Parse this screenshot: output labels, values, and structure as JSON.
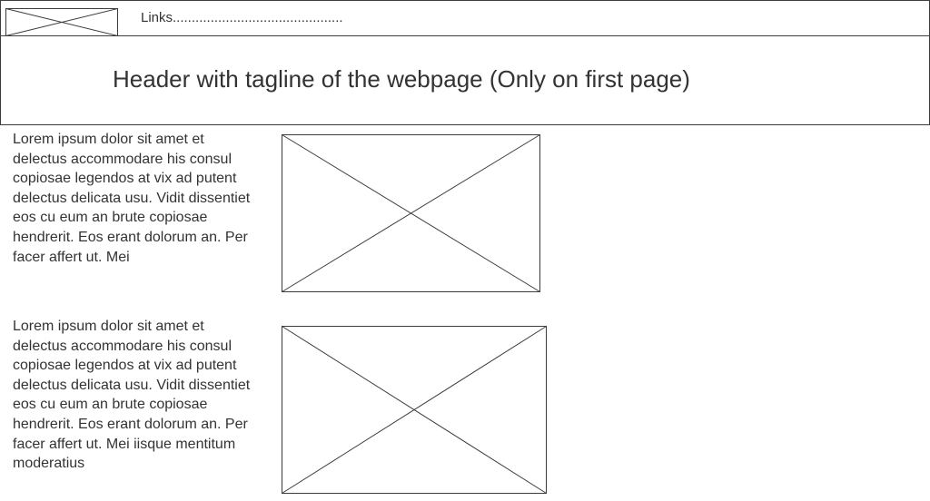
{
  "nav": {
    "links_label": "Links.............................................",
    "logo_icon": "image-placeholder-icon"
  },
  "header": {
    "tagline": "Header with tagline of the webpage (Only on first page)"
  },
  "sections": [
    {
      "text": "Lorem ipsum dolor sit amet et delectus accommodare his consul copiosae legendos at vix ad putent delectus delicata usu. Vidit dissentiet eos cu eum an brute copiosae hendrerit. Eos erant dolorum an. Per facer affert ut. Mei",
      "image_icon": "image-placeholder-icon"
    },
    {
      "text": "Lorem ipsum dolor sit amet et delectus accommodare his consul copiosae legendos at vix ad putent delectus delicata usu. Vidit dissentiet eos cu eum an brute copiosae hendrerit. Eos erant dolorum an. Per facer affert ut. Mei iisque mentitum moderatius",
      "image_icon": "image-placeholder-icon"
    }
  ],
  "colors": {
    "border": "#3c3c3c",
    "text": "#333333",
    "background": "#ffffff"
  }
}
